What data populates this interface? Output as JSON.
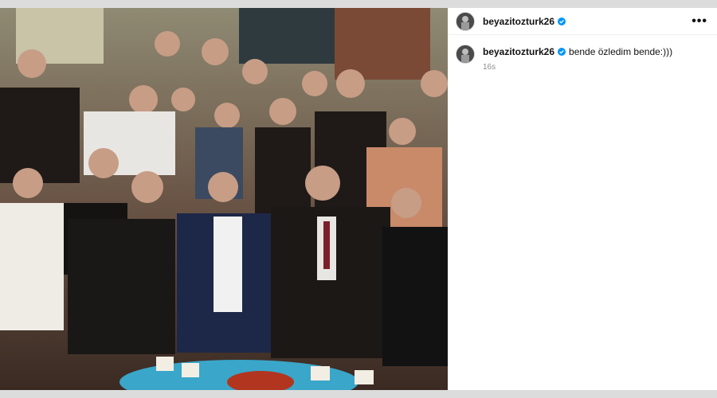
{
  "post": {
    "author": "beyazitozturk26",
    "more_icon": "more-horizontal-icon",
    "verified_color": "#0095f6"
  },
  "caption": {
    "author": "beyazitozturk26",
    "text": "bende özledim bende:)))",
    "time": "16s"
  }
}
